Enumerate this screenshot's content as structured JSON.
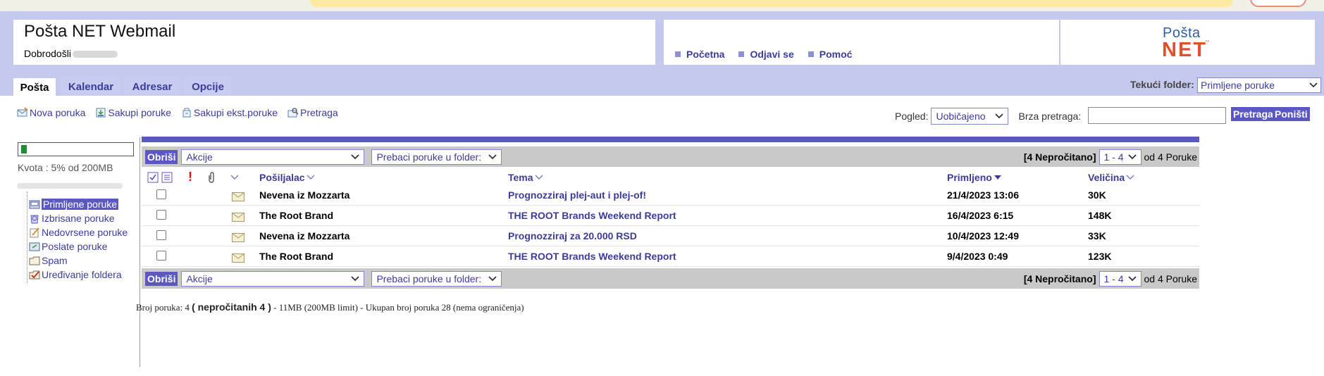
{
  "app": {
    "title": "Pošta NET Webmail",
    "welcome": "Dobrodošli",
    "logo_top": "Pošta",
    "logo_dots": "..",
    "logo_bottom": "NET"
  },
  "nav": [
    {
      "label": "Početna"
    },
    {
      "label": "Odjavi se"
    },
    {
      "label": "Pomoć"
    }
  ],
  "tabs": [
    {
      "label": "Pošta",
      "active": true
    },
    {
      "label": "Kalendar"
    },
    {
      "label": "Adresar"
    },
    {
      "label": "Opcije"
    }
  ],
  "current_folder": {
    "label": "Tekući folder:",
    "value": "Primljene poruke"
  },
  "toolbar": [
    {
      "label": "Nova poruka",
      "icon": "new-message-icon"
    },
    {
      "label": "Sakupi poruke",
      "icon": "collect-messages-icon"
    },
    {
      "label": "Sakupi ekst.poruke",
      "icon": "collect-external-icon"
    },
    {
      "label": "Pretraga",
      "icon": "search-icon"
    }
  ],
  "view": {
    "label": "Pogled:",
    "value": "Uobičajeno",
    "quick_search_label": "Brza pretraga:",
    "search_button": "Pretraga",
    "reset_button": "Poništi"
  },
  "quota": {
    "text": "Kvota : 5% od 200MB",
    "percent": 5
  },
  "folders": [
    {
      "label": "Primljene poruke",
      "selected": true,
      "icon": "inbox-icon"
    },
    {
      "label": "Izbrisane poruke",
      "icon": "trash-icon"
    },
    {
      "label": "Nedovrsene poruke",
      "icon": "drafts-icon"
    },
    {
      "label": "Poslate poruke",
      "icon": "sent-icon"
    },
    {
      "label": "Spam",
      "icon": "spam-folder-icon"
    },
    {
      "label": "Uređivanje foldera",
      "icon": "edit-folders-icon"
    }
  ],
  "action_bar": {
    "delete": "Obriši",
    "actions": "Akcije",
    "move": "Prebaci poruke u folder:",
    "unread": "[4 Nepročitano]",
    "range": "1 - 4",
    "total": "od 4 Poruke"
  },
  "columns": {
    "from": "Pošiljalac",
    "subject": "Tema",
    "received": "Primljeno",
    "size": "Veličina"
  },
  "messages": [
    {
      "from": "Nevena iz Mozzarta",
      "subject": "Prognozziraj plej-aut i plej-of!",
      "received": "21/4/2023 13:06",
      "size": "30K"
    },
    {
      "from": "The Root Brand",
      "subject": "THE ROOT Brands Weekend Report",
      "received": "16/4/2023 6:15",
      "size": "148K"
    },
    {
      "from": "Nevena iz Mozzarta",
      "subject": "Prognozziraj za 20.000 RSD",
      "received": "10/4/2023 12:49",
      "size": "33K"
    },
    {
      "from": "The Root Brand",
      "subject": "THE ROOT Brands Weekend Report",
      "received": "9/4/2023 0:49",
      "size": "123K"
    }
  ],
  "status": {
    "prefix": "Broj poruka: 4",
    "unread": "( nepročitanih 4 )",
    "suffix": "- 11MB (200MB limit) - Ukupan broj poruka 28 (nema ograničenja)"
  }
}
